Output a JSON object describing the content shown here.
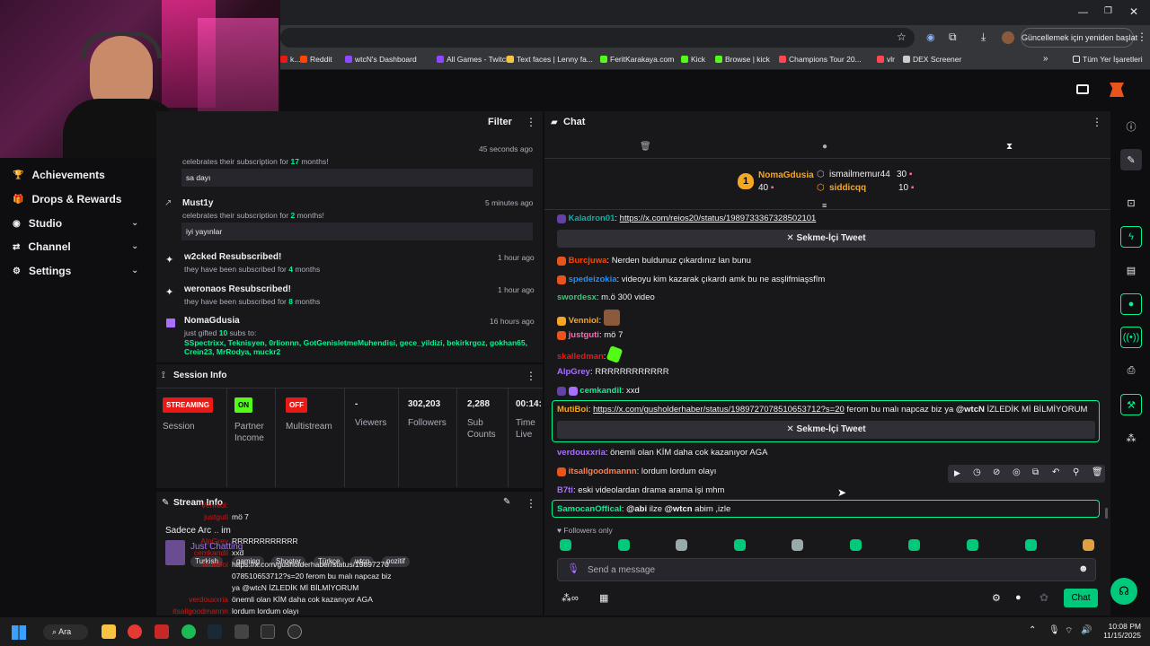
{
  "browser": {
    "update_button": "Güncellemek için yeniden başlat",
    "bookmarks": [
      {
        "label": "k...",
        "color": "#e91916"
      },
      {
        "label": "Reddit",
        "color": "#ff4500"
      },
      {
        "label": "wtcN's Dashboard",
        "color": "#9147ff"
      },
      {
        "label": "All Games - Twitch",
        "color": "#9147ff"
      },
      {
        "label": "Text faces | Lenny fa...",
        "color": "#f5c542"
      },
      {
        "label": "FeritKarakaya.com",
        "color": "#53fc18"
      },
      {
        "label": "Kick",
        "color": "#53fc18"
      },
      {
        "label": "Browse | kick",
        "color": "#53fc18"
      },
      {
        "label": "Champions Tour 20...",
        "color": "#ff4655"
      },
      {
        "label": "vlr",
        "color": "#ff4655"
      },
      {
        "label": "DEX Screener",
        "color": "#cccccc"
      }
    ],
    "all_bookmarks": "Tüm Yer İşaretleri"
  },
  "nav": [
    {
      "label": "Achievements",
      "icon": "trophy-icon",
      "chevron": false
    },
    {
      "label": "Drops & Rewards",
      "icon": "gift-icon",
      "chevron": false
    },
    {
      "label": "Studio",
      "icon": "camera-icon",
      "chevron": true
    },
    {
      "label": "Channel",
      "icon": "channel-icon",
      "chevron": true
    },
    {
      "label": "Settings",
      "icon": "gear-icon",
      "chevron": true
    }
  ],
  "activity": {
    "filter": "Filter",
    "items": [
      {
        "sub": "celebrates their subscription for ",
        "months": "17",
        "sub_tail": " months!",
        "time": "45 seconds ago",
        "message": "sa dayı"
      },
      {
        "name": "Must1y",
        "sub": "celebrates their subscription for ",
        "months": "2",
        "sub_tail": " months!",
        "time": "5 minutes ago",
        "message": "iyi yayınlar"
      },
      {
        "name": "w2cked Resubscribed!",
        "sub": "they have been subscribed for ",
        "months": "4",
        "sub_tail": " months",
        "time": "1 hour ago"
      },
      {
        "name": "weronaos Resubscribed!",
        "sub": "they have been subscribed for ",
        "months": "8",
        "sub_tail": " months",
        "time": "1 hour ago"
      },
      {
        "name": "NomaGdusia",
        "sub": "just gifted ",
        "months": "10",
        "sub_tail": " subs to:",
        "time": "16 hours ago",
        "recipients1": "SSpectrixx, Teknisyen, 0rlionnn, GotGenisletmeMuhendisi, gece_yildizi, bekirkrgoz, gokhan65,",
        "recipients2": "Crein23, MrRodya, muckr2"
      }
    ]
  },
  "session": {
    "title": "Session Info",
    "streaming": "STREAMING",
    "session_label": "Session",
    "on": "ON",
    "partner": "Partner",
    "income": "Income",
    "off": "OFF",
    "multistream": "Multistream",
    "viewers_val": "-",
    "viewers": "Viewers",
    "followers_val": "302,203",
    "followers": "Followers",
    "subs_val": "2,288",
    "sub": "Sub",
    "counts": "Counts",
    "time_val": "00:14:",
    "time": "Time",
    "live": "Live"
  },
  "stream_info": {
    "title": "Stream Info",
    "line1": "Sadece Arc",
    "line1b": "im",
    "category": "Just Chatting",
    "tags": [
      "Turkish",
      "gaming",
      "Shooter",
      "Türkçe",
      "wtcn",
      "pozitif"
    ],
    "overlay": [
      {
        "name": "Venniol:",
        "text": ""
      },
      {
        "name": "justguti",
        "text": "mö 7"
      },
      {
        "name": "AlpGrey",
        "text": "RRRRRRRRRRRR"
      },
      {
        "name": "cemkandil",
        "text": "xxd"
      },
      {
        "name": "MutiBoi",
        "text": "https://x.com/gusholderhaber/status/19897270"
      },
      {
        "name": "",
        "text": "078510653712?s=20 ferom bu malı napcaz biz"
      },
      {
        "name": "",
        "text": "ya @wtcN İZLEDİK Mİ BİLMİYORUM"
      },
      {
        "name": "verdouxxria",
        "text": "önemli olan KİM daha cok kazanıyor AGA"
      },
      {
        "name": "itsallgoodmannn",
        "text": "lordum lordum olayı"
      },
      {
        "name": "B7ti",
        "text": "eski videolardan drama arama işi mhm"
      }
    ]
  },
  "chat": {
    "title": "Chat",
    "leaderboard": {
      "rank": "1",
      "top_name": "NomaGdusia",
      "top_count": "40",
      "second_name": "ismailmemur44",
      "second_count": "30",
      "third_name": "siddicqq",
      "third_count": "10"
    },
    "messages": [
      {
        "name": "Kaladron01",
        "color": "#00b5ad",
        "text": "",
        "link": "https://x.com/reios20/status/1989733367328502101"
      },
      {
        "name": "Burcjuwa",
        "color": "#ff4500",
        "text": "Nerden buldunuz çıkardınız lan bunu"
      },
      {
        "name": "spedeizokia",
        "color": "#1e90ff",
        "text": "videoyu kim kazarak çıkardı amk bu ne asşlifmiaşsfîm"
      },
      {
        "name": "swordesx",
        "color": "#2ecc71",
        "text": "m.ö 300 video"
      },
      {
        "name": "Venniol",
        "color": "#f5a623",
        "text": ""
      },
      {
        "name": "justguti",
        "color": "#ff69b4",
        "text": "mö 7"
      },
      {
        "name": "skalledman",
        "color": "#e91916",
        "text": ""
      },
      {
        "name": "AlpGrey",
        "color": "#a970ff",
        "text": "RRRRRRRRRRRR"
      },
      {
        "name": "cemkandil",
        "color": "#00f593",
        "text": "xxd"
      },
      {
        "name": "MutiBoi",
        "color": "#f5a623",
        "link": "https://x.com/gusholderhaber/status/1989727078510653712?s=20",
        "text": " ferom bu malı napcaz biz ya ",
        "mention": "@wtcN",
        "tail": " İZLEDİK Mİ BİLMİYORUM"
      },
      {
        "name": "verdouxxria",
        "color": "#a970ff",
        "text": "önemli olan KİM daha cok kazanıyor AGA"
      },
      {
        "name": "itsallgoodmannn",
        "color": "#ff7f50",
        "text": "lordum lordum olayı"
      },
      {
        "name": "B7ti",
        "color": "#a970ff",
        "text": "eski videolardan drama arama işi mhm"
      },
      {
        "name": "SamocanOffical",
        "color": "#00f593",
        "mention1": "@abi",
        "text": " ilze ",
        "mention2": "@wtcn",
        "tail": " abim ,izle"
      }
    ],
    "tweet_button": "Sekme-İçi Tweet",
    "followers_only": "Followers only",
    "input_placeholder": "Send a message",
    "send": "Chat"
  },
  "taskbar": {
    "search": "Ara",
    "time": "10:08 PM",
    "date": "11/15/2025"
  },
  "colors": {
    "accent": "#9147ff",
    "kick_green": "#53fc18",
    "chat_highlight": "#00f593",
    "live_red": "#e91916"
  }
}
